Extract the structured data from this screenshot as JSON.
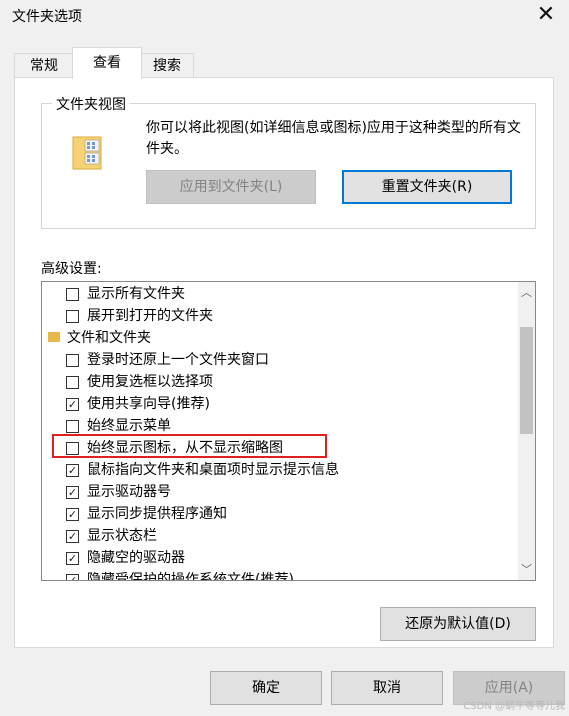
{
  "window": {
    "title": "文件夹选项",
    "close_symbol": "✕"
  },
  "tabs": [
    {
      "label": "常规",
      "active": false
    },
    {
      "label": "查看",
      "active": true
    },
    {
      "label": "搜索",
      "active": false
    }
  ],
  "folder_views": {
    "legend": "文件夹视图",
    "description": "你可以将此视图(如详细信息或图标)应用于这种类型的所有文件夹。",
    "apply_button": "应用到文件夹(L)",
    "reset_button": "重置文件夹(R)"
  },
  "advanced": {
    "label": "高级设置:",
    "items": [
      {
        "type": "checkbox",
        "text": "显示所有文件夹",
        "checked": false
      },
      {
        "type": "checkbox",
        "text": "展开到打开的文件夹",
        "checked": false
      },
      {
        "type": "folder",
        "text": "文件和文件夹"
      },
      {
        "type": "checkbox",
        "text": "登录时还原上一个文件夹窗口",
        "checked": false
      },
      {
        "type": "checkbox",
        "text": "使用复选框以选择项",
        "checked": false
      },
      {
        "type": "checkbox",
        "text": "使用共享向导(推荐)",
        "checked": true
      },
      {
        "type": "checkbox",
        "text": "始终显示菜单",
        "checked": false
      },
      {
        "type": "checkbox",
        "text": "始终显示图标，从不显示缩略图",
        "checked": false
      },
      {
        "type": "checkbox",
        "text": "鼠标指向文件夹和桌面项时显示提示信息",
        "checked": true
      },
      {
        "type": "checkbox",
        "text": "显示驱动器号",
        "checked": true
      },
      {
        "type": "checkbox",
        "text": "显示同步提供程序通知",
        "checked": true
      },
      {
        "type": "checkbox",
        "text": "显示状态栏",
        "checked": true
      },
      {
        "type": "checkbox",
        "text": "隐藏空的驱动器",
        "checked": true
      },
      {
        "type": "checkbox",
        "text": "隐藏受保护的操作系统文件(推荐)",
        "checked": true
      }
    ],
    "restore_button": "还原为默认值(D)"
  },
  "footer": {
    "ok": "确定",
    "cancel": "取消",
    "apply": "应用(A)"
  },
  "watermark": "CSDN @蜗牛等等儿我",
  "colors": {
    "accent": "#0078d7",
    "highlight": "#e02020"
  }
}
